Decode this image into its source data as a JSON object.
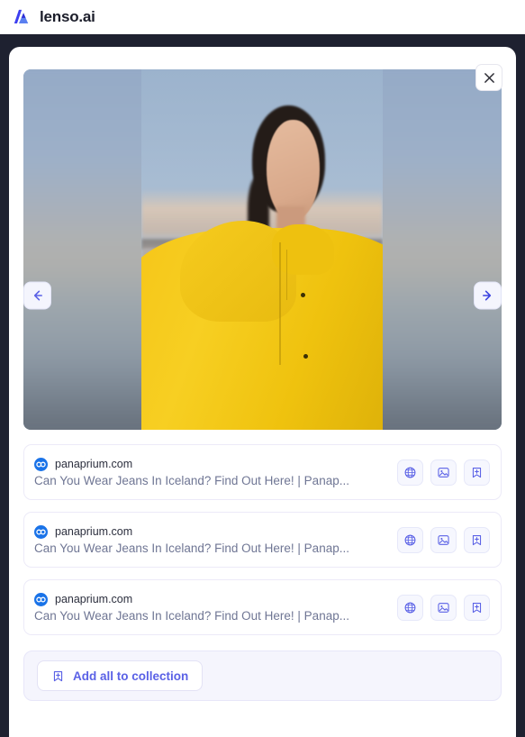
{
  "header": {
    "brand_name": "lenso.ai",
    "logo_icon": "lenso-a-logo-icon"
  },
  "modal": {
    "close_label": "×",
    "close_icon": "close-icon",
    "prev_icon": "arrow-left-icon",
    "next_icon": "arrow-right-icon",
    "image_alt": "Woman in yellow raincoat standing in front of a blurred bridge and water"
  },
  "results": [
    {
      "domain": "panaprium.com",
      "title": "Can You Wear Jeans In Iceland? Find Out Here! | Panap...",
      "favicon": "panaprium-infinity-favicon",
      "actions": [
        {
          "name": "open-website",
          "icon": "globe-icon"
        },
        {
          "name": "open-image",
          "icon": "image-icon"
        },
        {
          "name": "add-to-collection",
          "icon": "bookmark-plus-icon"
        }
      ]
    },
    {
      "domain": "panaprium.com",
      "title": "Can You Wear Jeans In Iceland? Find Out Here! | Panap...",
      "favicon": "panaprium-infinity-favicon",
      "actions": [
        {
          "name": "open-website",
          "icon": "globe-icon"
        },
        {
          "name": "open-image",
          "icon": "image-icon"
        },
        {
          "name": "add-to-collection",
          "icon": "bookmark-plus-icon"
        }
      ]
    },
    {
      "domain": "panaprium.com",
      "title": "Can You Wear Jeans In Iceland? Find Out Here! | Panap...",
      "favicon": "panaprium-infinity-favicon",
      "actions": [
        {
          "name": "open-website",
          "icon": "globe-icon"
        },
        {
          "name": "open-image",
          "icon": "image-icon"
        },
        {
          "name": "add-to-collection",
          "icon": "bookmark-plus-icon"
        }
      ]
    }
  ],
  "footer": {
    "add_all_label": "Add all to collection",
    "add_all_icon": "bookmark-plus-icon"
  },
  "colors": {
    "accent": "#5a61e6",
    "text_dark": "#2c2f3e",
    "text_muted": "#6f7694",
    "overlay": "#1e2130",
    "panel_tint": "#f5f5fd"
  }
}
